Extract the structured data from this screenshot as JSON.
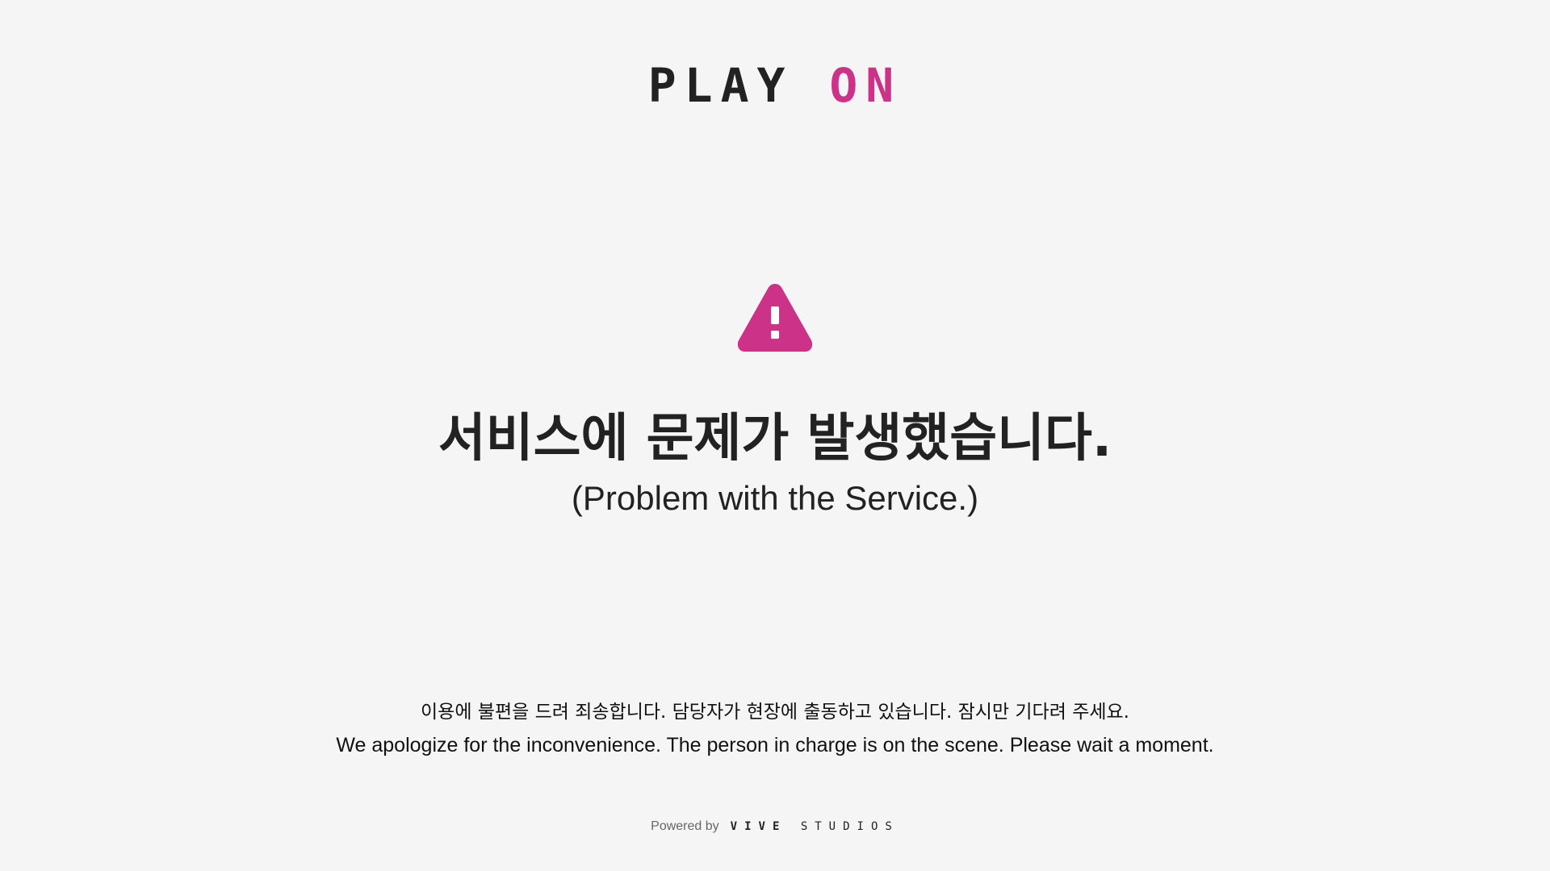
{
  "logo": {
    "part1": "PLAY",
    "part2": "ON"
  },
  "alert": {
    "icon": "warning-triangle-icon",
    "color": "#cc3388"
  },
  "headline": "서비스에 문제가 발생했습니다.",
  "subheadline": "(Problem with the Service.)",
  "message": {
    "korean": "이용에 불편을 드려 죄송합니다. 담당자가 현장에 출동하고 있습니다. 잠시만 기다려 주세요.",
    "english": "We apologize for the inconvenience. The person in charge is on the scene. Please wait a moment."
  },
  "footer": {
    "powered_by": "Powered by",
    "brand_part1": "VIVE",
    "brand_part2": "STUDIOS"
  },
  "colors": {
    "accent": "#cc3388",
    "background": "#f5f5f5",
    "text": "#222222"
  }
}
